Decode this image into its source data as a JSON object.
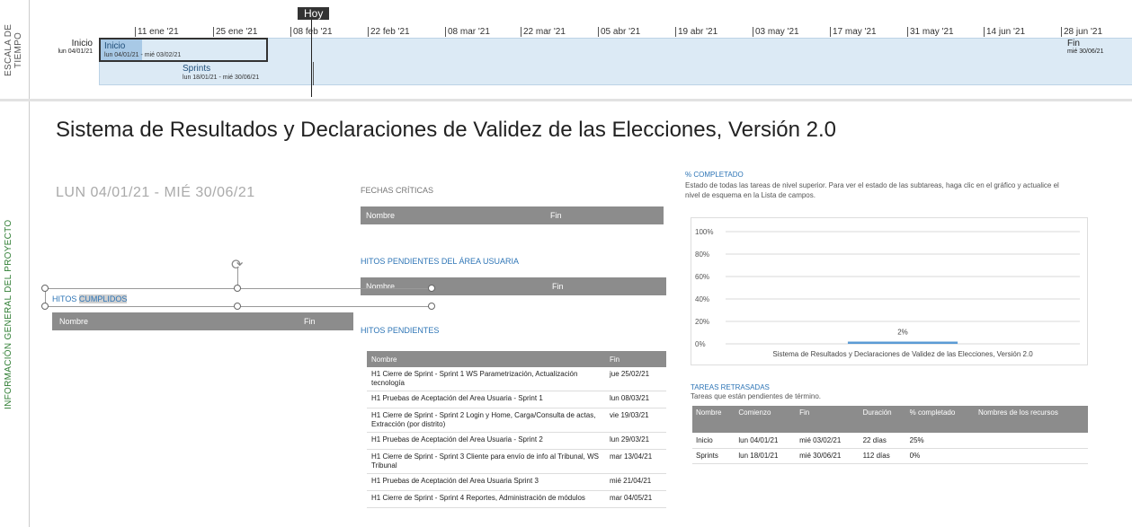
{
  "sidebar": {
    "timeline_label": "ESCALA DE TIEMPO",
    "overview_label": "INFORMACIÓN GENERAL DEL PROYECTO"
  },
  "timeline": {
    "ticks": [
      "11 ene '21",
      "25 ene '21",
      "08 feb '21",
      "22 feb '21",
      "08 mar '21",
      "22 mar '21",
      "05 abr '21",
      "19 abr '21",
      "03 may '21",
      "17 may '21",
      "31 may '21",
      "14 jun '21",
      "28 jun '21"
    ],
    "today_label": "Hoy",
    "start": {
      "label": "Inicio",
      "date": "lun 04/01/21"
    },
    "end": {
      "label": "Fin",
      "date": "mié 30/06/21"
    },
    "tasks": [
      {
        "name": "Inicio",
        "dates": "lun 04/01/21 - mié 03/02/21",
        "progress": 0.25
      },
      {
        "name": "Sprints",
        "dates": "lun 18/01/21 - mié 30/06/21"
      }
    ]
  },
  "overview": {
    "title": "Sistema de Resultados y Declaraciones de Validez de las Elecciones, Versión 2.0",
    "date_range": "LUN 04/01/21 -  MIÉ 30/06/21"
  },
  "fechas_criticas": {
    "heading": "FECHAS CRÍTICAS",
    "columns": [
      "Nombre",
      "Fin"
    ]
  },
  "hitos_area_usuaria": {
    "heading": "HITOS PENDIENTES DEL ÁREA USUARIA",
    "columns": [
      "Nombre",
      "Fin"
    ]
  },
  "hitos_cumplidos": {
    "heading_a": "HITOS ",
    "heading_b": "CUMPLIDOS",
    "columns": [
      "Nombre",
      "Fin"
    ]
  },
  "hitos_pendientes": {
    "heading": "HITOS PENDIENTES",
    "columns": [
      "Nombre",
      "Fin"
    ],
    "rows": [
      [
        "H1 Cierre de Sprint - Sprint 1 WS Parametrización, Actualización tecnología",
        "jue 25/02/21"
      ],
      [
        "H1 Pruebas de Aceptación del Area Usuaria - Sprint 1",
        "lun 08/03/21"
      ],
      [
        "H1 Cierre de Sprint - Sprint 2 Login y Home, Carga/Consulta de actas, Extracción (por distrito)",
        "vie 19/03/21"
      ],
      [
        "H1 Pruebas de Aceptación del Area Usuaria - Sprint 2",
        "lun 29/03/21"
      ],
      [
        "H1 Cierre de Sprint - Sprint 3 Cliente para envío de info al Tribunal, WS Tribunal",
        "mar 13/04/21"
      ],
      [
        "H1 Pruebas de Aceptación del Area Usuaria Sprint 3",
        "mié 21/04/21"
      ],
      [
        "H1 Cierre de Sprint - Sprint 4 Reportes, Administración de módulos",
        "mar 04/05/21"
      ]
    ]
  },
  "completado": {
    "heading": "% COMPLETADO",
    "description": "Estado de todas las tareas de nivel superior. Para ver el estado de las subtareas, haga clic en el gráfico y actualice el nivel de esquema en la Lista de campos.",
    "bar_color": "#5b9bd5"
  },
  "chart_data": {
    "type": "bar",
    "categories": [
      "Sistema de Resultados y Declaraciones de Validez de las Elecciones, Versión 2.0"
    ],
    "values": [
      2
    ],
    "data_labels": [
      "2%"
    ],
    "yticks": [
      "100%",
      "80%",
      "60%",
      "40%",
      "20%",
      "0%"
    ],
    "ylim": [
      0,
      100
    ],
    "grid": true
  },
  "tareas_retrasadas": {
    "heading": "TAREAS RETRASADAS",
    "subtitle": "Tareas que están pendientes de término.",
    "columns": [
      "Nombre",
      "Comienzo",
      "Fin",
      "Duración",
      "% completado",
      "Nombres de los recursos"
    ],
    "rows": [
      [
        "Inicio",
        "lun 04/01/21",
        "mié 03/02/21",
        "22 días",
        "25%",
        ""
      ],
      [
        "Sprints",
        "lun 18/01/21",
        "mié 30/06/21",
        "112 días",
        "0%",
        ""
      ]
    ]
  }
}
